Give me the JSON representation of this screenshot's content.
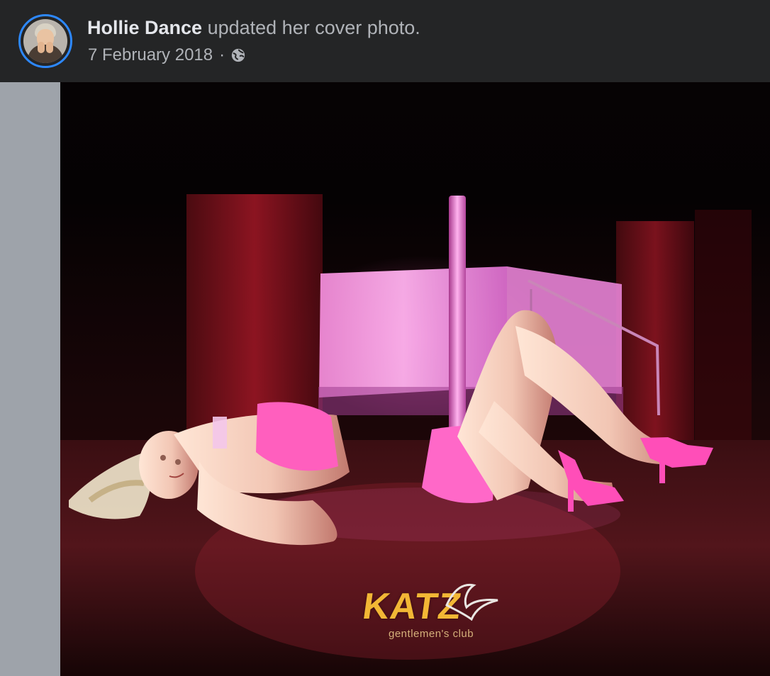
{
  "post": {
    "author_name": "Hollie Dance",
    "action_text": "updated her cover photo.",
    "date": "7 February 2018",
    "separator": "·",
    "privacy_icon": "globe-icon"
  },
  "photo": {
    "logo_text": "KATZ",
    "logo_subtext": "gentlemen's club"
  },
  "colors": {
    "background": "#242526",
    "text_primary": "#e4e6eb",
    "text_secondary": "#b0b3b8",
    "avatar_ring": "#2d88ff",
    "left_gutter": "#9ea3aa"
  }
}
